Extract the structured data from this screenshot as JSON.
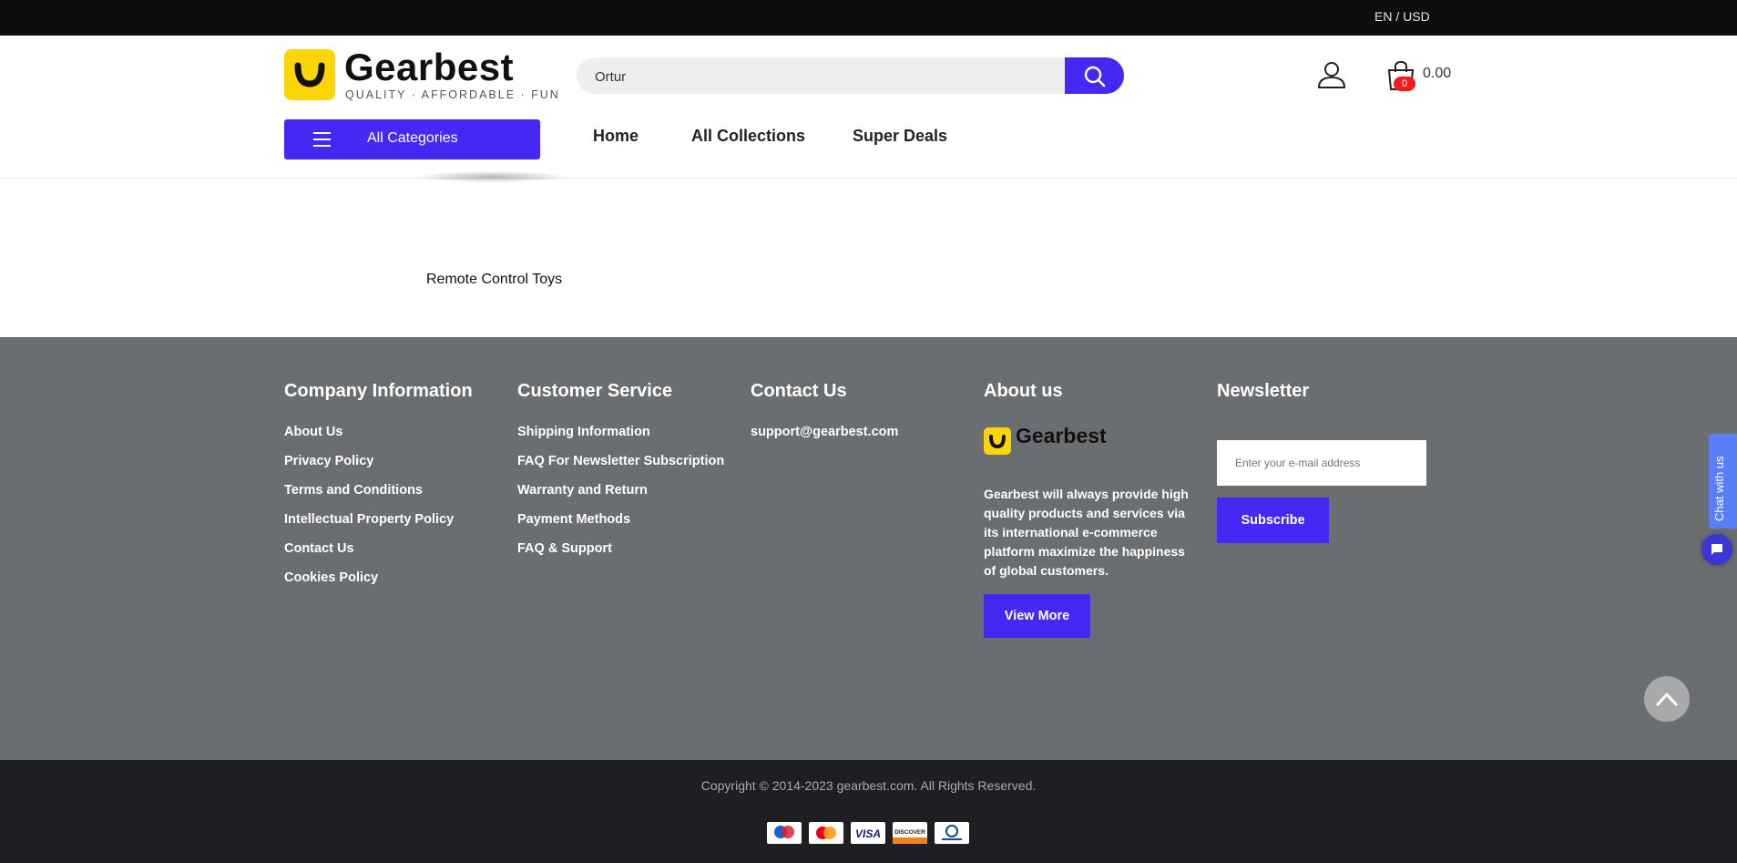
{
  "topbar": {
    "lang_currency": "EN / USD"
  },
  "header": {
    "logo_word": "Gearbest",
    "logo_tagline": "QUALITY · AFFORDABLE · FUN",
    "search_value": "Ortur",
    "cart_count": "0",
    "cart_total": "0.00",
    "all_categories": "All Categories",
    "nav": [
      "Home",
      "All Collections",
      "Super Deals"
    ]
  },
  "product": {
    "label": "Remote Control Toys"
  },
  "footer": {
    "company": {
      "title": "Company Information",
      "links": [
        "About Us",
        "Privacy Policy",
        "Terms and Conditions",
        "Intellectual Property Policy",
        "Contact Us",
        "Cookies Policy"
      ]
    },
    "service": {
      "title": "Customer Service",
      "links": [
        "Shipping Information",
        "FAQ For Newsletter Subscription",
        "Warranty and Return",
        "Payment Methods",
        "FAQ & Support"
      ]
    },
    "contact": {
      "title": "Contact Us",
      "email": "support@gearbest.com"
    },
    "about": {
      "title": "About us",
      "logo_word": "Gearbest",
      "text": "Gearbest will always provide high quality products and services via its international e-commerce platform maximize the happiness of global customers.",
      "view_more": "View More"
    },
    "newsletter": {
      "title": "Newsletter",
      "placeholder": "Enter your e-mail address",
      "subscribe": "Subscribe"
    }
  },
  "chat": {
    "label": "Chat with us"
  },
  "bottom": {
    "copyright": "Copyright © 2014-2023 gearbest.com. All Rights Reserved.",
    "payments": [
      "maestro-icon",
      "mastercard-icon",
      "visa-icon",
      "discover-icon",
      "diners-club-icon"
    ],
    "payment_labels": {
      "visa": "VISA",
      "discover": "DISCOVER"
    }
  },
  "colors": {
    "brand_yellow": "#fcd507",
    "accent_blue": "#4628f3",
    "footer_gray": "#6b6e71",
    "badge_red": "#f41a1a"
  }
}
